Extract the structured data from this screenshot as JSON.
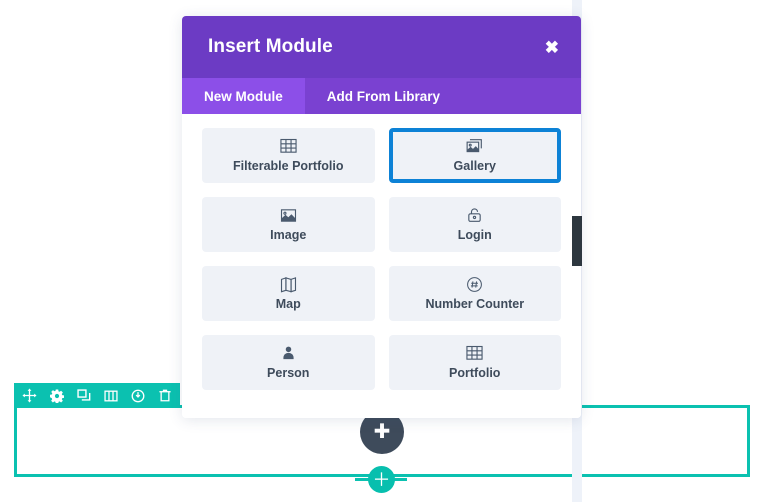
{
  "modal": {
    "title": "Insert Module",
    "close_label": "✖",
    "tabs": [
      {
        "label": "New Module",
        "active": true
      },
      {
        "label": "Add From Library",
        "active": false
      }
    ],
    "modules": [
      {
        "label": "Filterable Portfolio",
        "icon": "grid-icon",
        "selected": false
      },
      {
        "label": "Gallery",
        "icon": "gallery-icon",
        "selected": true
      },
      {
        "label": "Image",
        "icon": "image-icon",
        "selected": false
      },
      {
        "label": "Login",
        "icon": "lock-icon",
        "selected": false
      },
      {
        "label": "Map",
        "icon": "map-icon",
        "selected": false
      },
      {
        "label": "Number Counter",
        "icon": "hash-circle-icon",
        "selected": false
      },
      {
        "label": "Person",
        "icon": "person-icon",
        "selected": false
      },
      {
        "label": "Portfolio",
        "icon": "grid-icon",
        "selected": false
      }
    ]
  },
  "builder": {
    "row_toolbar": [
      {
        "name": "move-icon"
      },
      {
        "name": "settings-gear-icon"
      },
      {
        "name": "duplicate-icon"
      },
      {
        "name": "columns-icon"
      },
      {
        "name": "disable-power-icon"
      },
      {
        "name": "trash-icon"
      }
    ],
    "insert_circle_label": "✚",
    "add_module_label": "＋"
  },
  "colors": {
    "header_purple": "#6c3bc4",
    "tab_bar_purple": "#7a41d1",
    "tab_active_purple": "#8c4fe8",
    "selected_blue": "#0d82d6",
    "tile_bg": "#eff2f7",
    "label_slate": "#3e4b5b",
    "teal": "#0bc1b0",
    "green_add": "#07bfae",
    "dark_slate": "#3e4b5b",
    "scrollbar_thumb": "#2d373f"
  }
}
